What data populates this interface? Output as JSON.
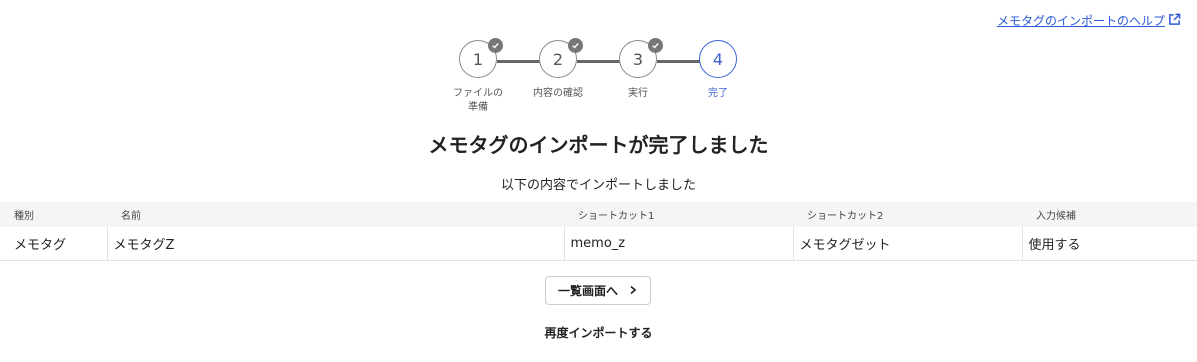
{
  "help_link": {
    "label": "メモタグのインポートのヘルプ"
  },
  "stepper": {
    "steps": [
      {
        "number": "1",
        "label": "ファイルの準備",
        "done": true
      },
      {
        "number": "2",
        "label": "内容の確認",
        "done": true
      },
      {
        "number": "3",
        "label": "実行",
        "done": true
      },
      {
        "number": "4",
        "label": "完了",
        "done": false,
        "active": true
      }
    ]
  },
  "title": "メモタグのインポートが完了しました",
  "subtitle": "以下の内容でインポートしました",
  "table": {
    "headers": [
      "種別",
      "名前",
      "ショートカット1",
      "ショートカット2",
      "入力候補"
    ],
    "rows": [
      [
        "メモタグ",
        "メモタグZ",
        "memo_z",
        "メモタグゼット",
        "使用する"
      ]
    ]
  },
  "actions": {
    "list_button": "一覧画面へ",
    "reimport_link": "再度インポートする"
  },
  "colors": {
    "accent": "#3b63d1",
    "link": "#2b5bd7"
  }
}
